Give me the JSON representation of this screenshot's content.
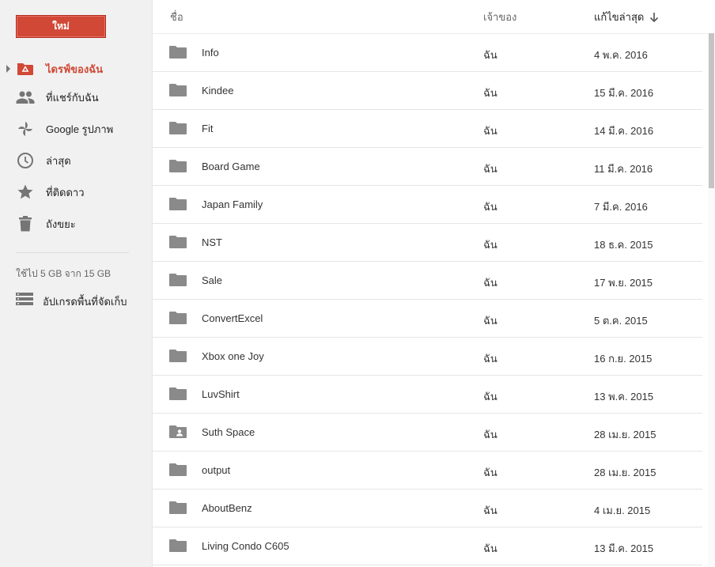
{
  "sidebar": {
    "new_button": "ใหม่",
    "items": [
      {
        "label": "ไดรฟ์ของฉัน",
        "icon": "drive-folder-icon"
      },
      {
        "label": "ที่แชร์กับฉัน",
        "icon": "people-icon"
      },
      {
        "label": "Google รูปภาพ",
        "icon": "pinwheel-icon"
      },
      {
        "label": "ล่าสุด",
        "icon": "clock-icon"
      },
      {
        "label": "ที่ติดดาว",
        "icon": "star-icon"
      },
      {
        "label": "ถังขยะ",
        "icon": "trash-icon"
      }
    ],
    "storage_text": "ใช้ไป 5 GB จาก 15 GB",
    "upgrade_label": "อัปเกรดพื้นที่จัดเก็บ"
  },
  "list": {
    "headers": {
      "name": "ชื่อ",
      "owner": "เจ้าของ",
      "modified": "แก้ไขล่าสุด"
    },
    "rows": [
      {
        "name": "Info",
        "owner": "ฉัน",
        "modified": "4 พ.ค. 2016",
        "icon": "folder-icon"
      },
      {
        "name": "Kindee",
        "owner": "ฉัน",
        "modified": "15 มี.ค. 2016",
        "icon": "folder-icon"
      },
      {
        "name": "Fit",
        "owner": "ฉัน",
        "modified": "14 มี.ค. 2016",
        "icon": "folder-icon"
      },
      {
        "name": "Board Game",
        "owner": "ฉัน",
        "modified": "11 มี.ค. 2016",
        "icon": "folder-icon"
      },
      {
        "name": "Japan Family",
        "owner": "ฉัน",
        "modified": "7 มี.ค. 2016",
        "icon": "folder-icon"
      },
      {
        "name": "NST",
        "owner": "ฉัน",
        "modified": "18 ธ.ค. 2015",
        "icon": "folder-icon"
      },
      {
        "name": "Sale",
        "owner": "ฉัน",
        "modified": "17 พ.ย. 2015",
        "icon": "folder-icon"
      },
      {
        "name": "ConvertExcel",
        "owner": "ฉัน",
        "modified": "5 ต.ค. 2015",
        "icon": "folder-icon"
      },
      {
        "name": "Xbox one Joy",
        "owner": "ฉัน",
        "modified": "16 ก.ย. 2015",
        "icon": "folder-icon"
      },
      {
        "name": "LuvShirt",
        "owner": "ฉัน",
        "modified": "13 พ.ค. 2015",
        "icon": "folder-icon"
      },
      {
        "name": "Suth Space",
        "owner": "ฉัน",
        "modified": "28 เม.ย. 2015",
        "icon": "shared-folder-icon"
      },
      {
        "name": "output",
        "owner": "ฉัน",
        "modified": "28 เม.ย. 2015",
        "icon": "folder-icon"
      },
      {
        "name": "AboutBenz",
        "owner": "ฉัน",
        "modified": "4 เม.ย. 2015",
        "icon": "folder-icon"
      },
      {
        "name": "Living Condo C605",
        "owner": "ฉัน",
        "modified": "13 มี.ค. 2015",
        "icon": "folder-icon"
      }
    ]
  },
  "colors": {
    "accent": "#d14836",
    "icon": "#8a8a8a",
    "sidebar_bg": "#f1f1f1"
  }
}
